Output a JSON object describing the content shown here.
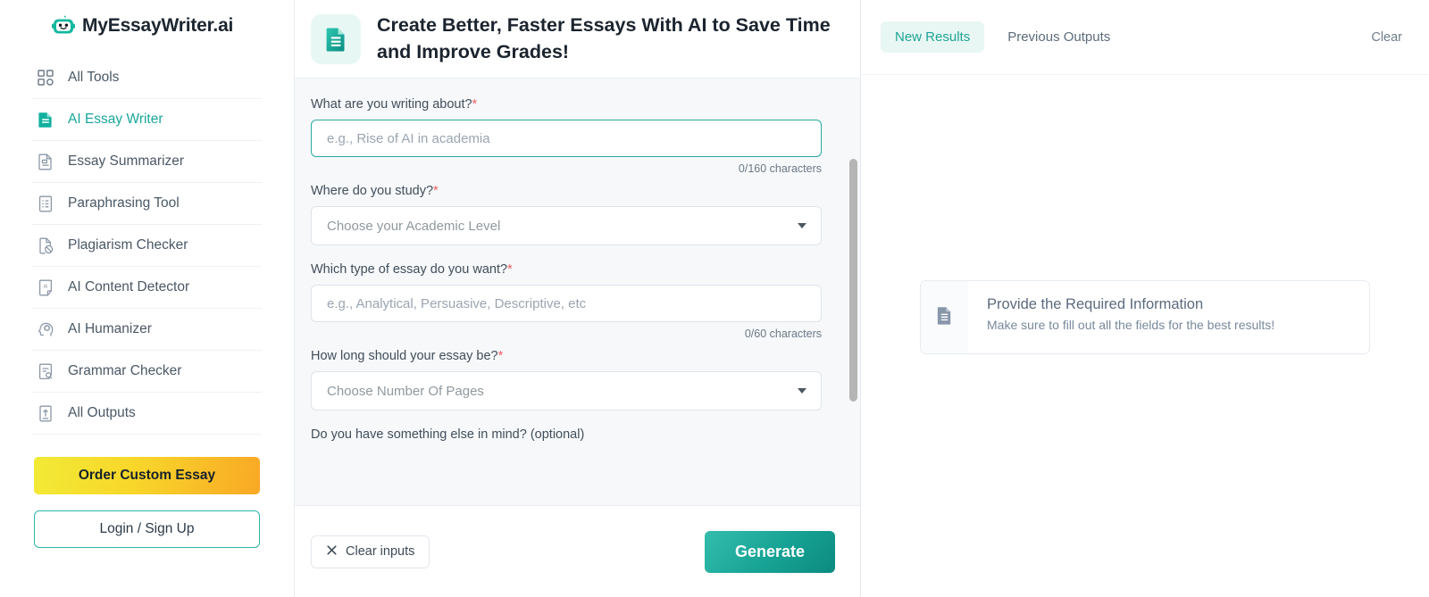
{
  "brand": {
    "name": "MyEssayWriter.ai",
    "logo_icon": "robot-head-icon",
    "accent": "#1aa79a",
    "accent_dark": "#0d8b80"
  },
  "sidebar": {
    "items": [
      {
        "label": "All Tools",
        "icon": "grid-icon",
        "active": false
      },
      {
        "label": "AI Essay Writer",
        "icon": "document-filled-icon",
        "active": true
      },
      {
        "label": "Essay Summarizer",
        "icon": "document-summary-icon",
        "active": false
      },
      {
        "label": "Paraphrasing Tool",
        "icon": "document-list-icon",
        "active": false
      },
      {
        "label": "Plagiarism Checker",
        "icon": "document-blocked-icon",
        "active": false
      },
      {
        "label": "AI Content Detector",
        "icon": "ai-page-icon",
        "active": false
      },
      {
        "label": "AI Humanizer",
        "icon": "head-gear-icon",
        "active": false
      },
      {
        "label": "Grammar Checker",
        "icon": "document-search-icon",
        "active": false
      },
      {
        "label": "All Outputs",
        "icon": "document-upload-icon",
        "active": false
      }
    ],
    "order_button": "Order Custom Essay",
    "login_button": "Login / Sign Up"
  },
  "main": {
    "header_icon": "document-teal-icon",
    "title": "Create Better, Faster Essays With AI to Save Time and Improve Grades!",
    "fields": [
      {
        "label": "What are you writing about?",
        "required": true,
        "type": "text",
        "value": "",
        "placeholder": "e.g., Rise of AI in academia",
        "counter": "0/160 characters",
        "focused": true
      },
      {
        "label": "Where do you study?",
        "required": true,
        "type": "select",
        "value": "Choose your Academic Level"
      },
      {
        "label": "Which type of essay do you want?",
        "required": true,
        "type": "text",
        "value": "",
        "placeholder": "e.g., Analytical, Persuasive, Descriptive, etc",
        "counter": "0/60 characters",
        "focused": false
      },
      {
        "label": "How long should your essay be?",
        "required": true,
        "type": "select",
        "value": "Choose Number Of Pages"
      },
      {
        "label": "Do you have something else in mind? (optional)",
        "required": false,
        "type": "textarea"
      }
    ],
    "clear_button": "Clear inputs",
    "clear_icon": "close-x-icon",
    "generate_button": "Generate"
  },
  "right": {
    "tabs": [
      {
        "label": "New Results",
        "active": true
      },
      {
        "label": "Previous Outputs",
        "active": false
      }
    ],
    "clear_link": "Clear",
    "info_card": {
      "icon": "document-info-icon",
      "title": "Provide the Required Information",
      "subtitle": "Make sure to fill out all the fields for the best results!"
    }
  }
}
